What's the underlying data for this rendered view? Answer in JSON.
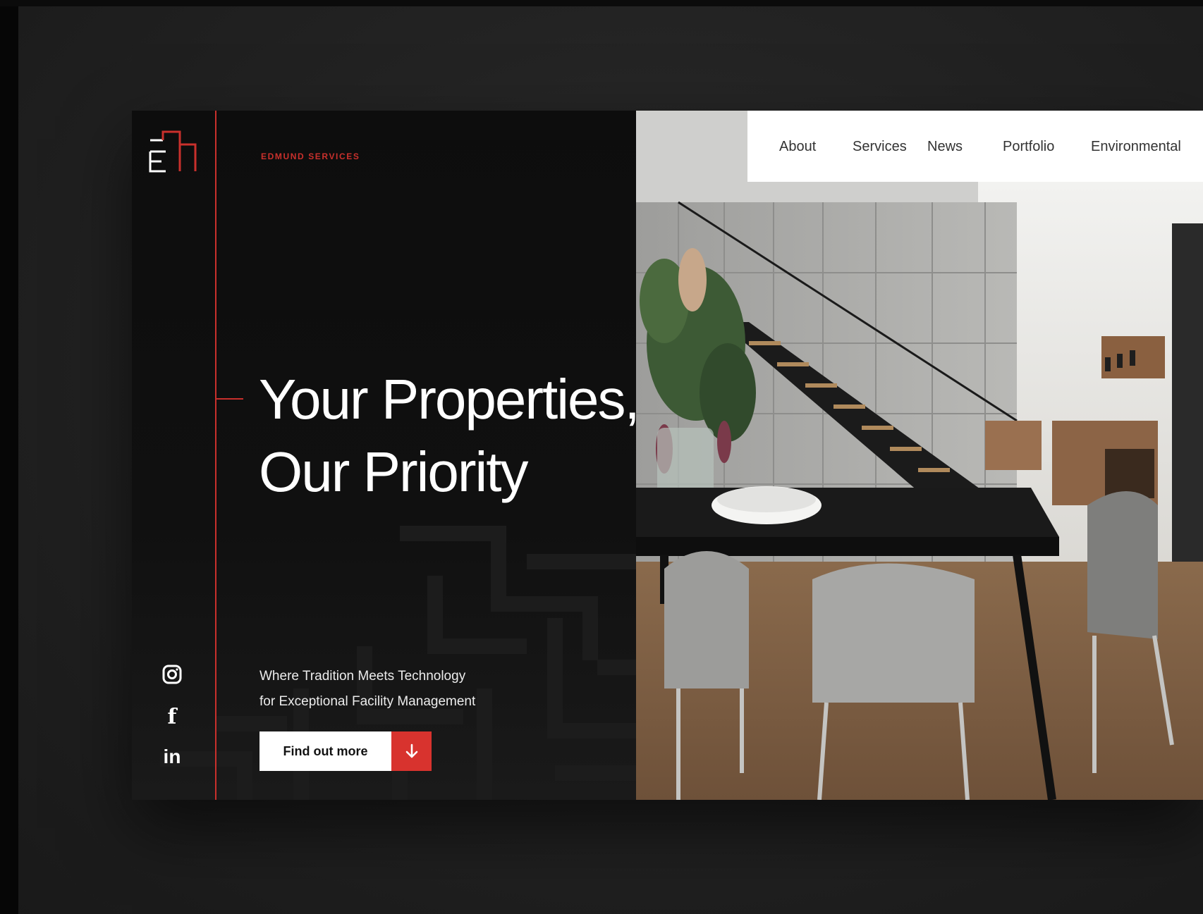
{
  "brand": {
    "name": "EDMUND SERVICES",
    "logo_icon": "eh-monogram-logo",
    "accent_color": "#c9302c"
  },
  "nav": {
    "items": [
      {
        "label": "About"
      },
      {
        "label": "Services"
      },
      {
        "label": "News"
      },
      {
        "label": "Portfolio"
      },
      {
        "label": "Environmental"
      }
    ]
  },
  "hero": {
    "headline_line1": "Your Properties,",
    "headline_line2": "Our Priority",
    "tagline_line1": "Where Tradition Meets Technology",
    "tagline_line2": "for Exceptional Facility Management",
    "cta_label": "Find out more",
    "cta_icon": "arrow-down-icon",
    "cta_color": "#d8332e"
  },
  "social": {
    "icons": [
      "instagram-icon",
      "facebook-icon",
      "linkedin-icon"
    ],
    "facebook_glyph": "f",
    "linkedin_glyph": "in"
  },
  "image": {
    "subject": "modern-dining-room-photo"
  }
}
